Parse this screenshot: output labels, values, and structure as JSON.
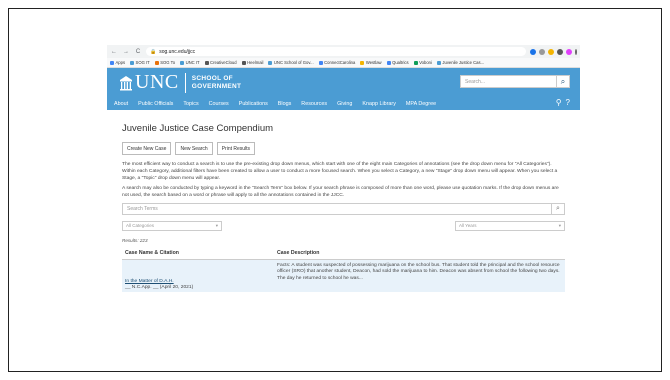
{
  "browser": {
    "url": "sog.unc.edu/jjcc",
    "bookmarks": [
      "Apps",
      "SOG IT",
      "SOG To",
      "UNC IT",
      "CreativeCloud",
      "Heelmail",
      "UNC School of Gov...",
      "ConnectCarolina",
      "Westlaw",
      "Qualtrics",
      "Voboni",
      "Juvenile Justice Cas..."
    ]
  },
  "header": {
    "logo_text": "UNC",
    "school_line1": "SCHOOL OF",
    "school_line2": "GOVERNMENT",
    "search_placeholder": "Search..."
  },
  "nav": {
    "items": [
      "About",
      "Public Officials",
      "Topics",
      "Courses",
      "Publications",
      "Blogs",
      "Resources",
      "Giving",
      "Knapp Library",
      "MPA Degree"
    ]
  },
  "main": {
    "title": "Juvenile Justice Case Compendium",
    "buttons": [
      "Create New Case",
      "New Search",
      "Print Results"
    ],
    "para1": "The most efficient way to conduct a search is to use the pre-existing drop down menus, which start with one of the eight main Categories of annotations (see the drop down menu for \"All Categories\"). Within each Category, additional filters have been created to allow a user to conduct a more focused search. When you select a Category, a new \"Stage\" drop down menu will appear. When you select a Stage, a \"Topic\" drop down menu will appear.",
    "para2": "A search may also be conducted by typing a keyword in the \"Search Term\" box below. If your search phrase is composed of more than one word, please use quotation marks. If the drop down menus are not used, the search based on a word or phrase will apply to all the annotations contained in the JJCC.",
    "search_terms_placeholder": "Search Terms",
    "category_select": "All Categories",
    "years_select": "All Years",
    "results": "Results: 223"
  },
  "table": {
    "headers": [
      "Case Name & Citation",
      "Case Description"
    ],
    "rows": [
      {
        "case_name": "In the Matter of D.A.H.",
        "citation": "__ N.C.App. __ (April 20, 2021)",
        "description": "Facts: A student was suspected of possessing marijuana on the school bus. That student told the principal and the school resource officer (SRO) that another student, Deacon, had sold the marijuana to him. Deacon was absent from school the following two days. The day he returned to school he was..."
      }
    ]
  },
  "colors": {
    "unc_blue": "#4b9cd3",
    "row_highlight": "#e8f2fa",
    "link": "#1d4f74"
  }
}
